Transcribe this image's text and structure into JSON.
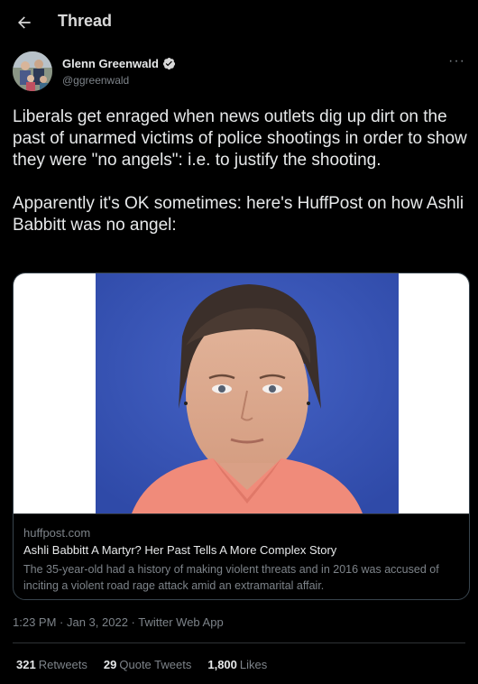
{
  "header": {
    "title": "Thread",
    "back_icon": "arrow-left-icon"
  },
  "author": {
    "name": "Glenn Greenwald",
    "handle": "@ggreenwald",
    "verified": true,
    "more_label": "···"
  },
  "tweet": {
    "text": "Liberals get enraged when news outlets dig up dirt on the past of unarmed victims of police shootings in order to show they were \"no angels\": i.e. to justify the shooting.\n\nApparently it's OK sometimes: here's HuffPost on how Ashli Babbitt was no angel:"
  },
  "card": {
    "domain": "huffpost.com",
    "title": "Ashli Babbitt A Martyr? Her Past Tells A More Complex Story",
    "description": "The 35-year-old had a history of making violent threats and in 2016 was accused of inciting a violent road rage attack amid an extramarital affair."
  },
  "meta": {
    "time": "1:23 PM",
    "date": "Jan 3, 2022",
    "source": "Twitter Web App",
    "separator": " · "
  },
  "stats": {
    "retweets_count": "321",
    "retweets_label": "Retweets",
    "quotes_count": "29",
    "quotes_label": "Quote Tweets",
    "likes_count": "1,800",
    "likes_label": "Likes"
  },
  "colors": {
    "background": "#000000",
    "text": "#e7e9ea",
    "muted": "#7d8389",
    "verified": "#d9d9d9",
    "photo_background": "#3a55b8"
  }
}
